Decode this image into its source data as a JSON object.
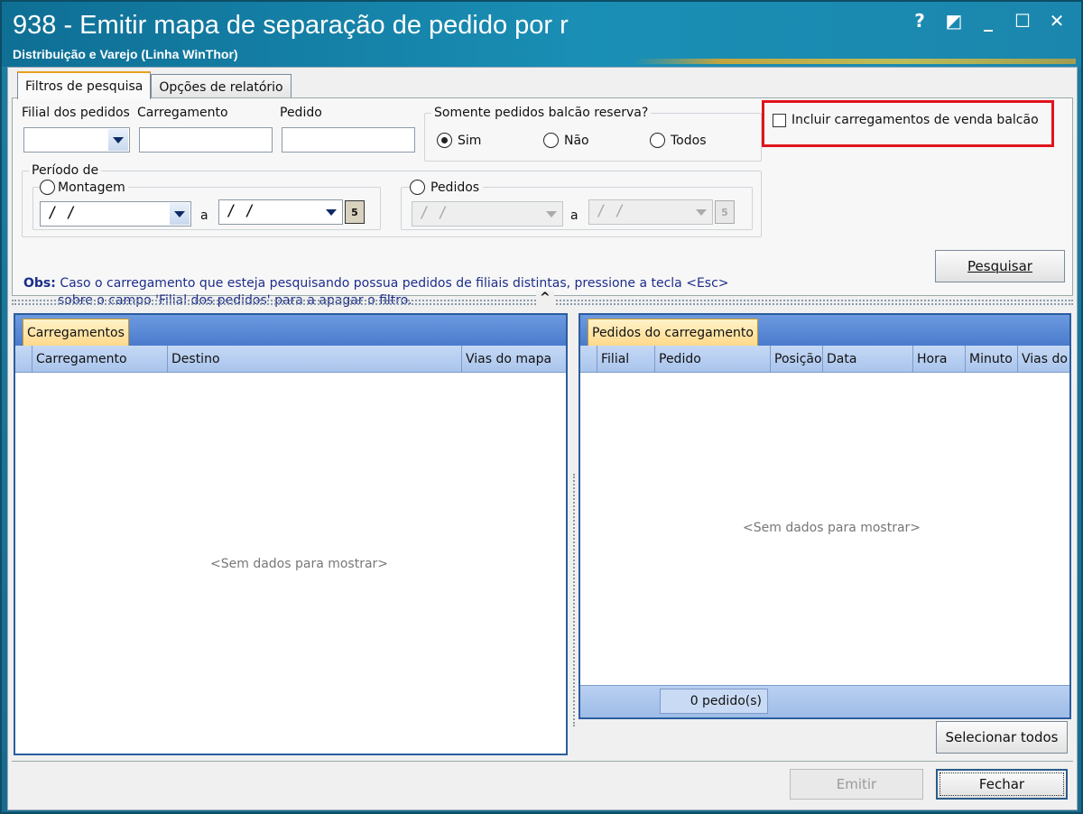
{
  "window": {
    "title": "938 - Emitir mapa de separação de pedido por r",
    "subtitle": "Distribuição e Varejo (Linha WinThor)",
    "controls": [
      "?",
      "◩",
      "_",
      "☐",
      "✕"
    ]
  },
  "tabs": [
    {
      "label": "Filtros de pesquisa",
      "active": true
    },
    {
      "label": "Opções de relatório",
      "active": false
    }
  ],
  "filters": {
    "filial_label": "Filial dos pedidos",
    "filial_value": "",
    "carregamento_label": "Carregamento",
    "carregamento_value": "",
    "pedido_label": "Pedido",
    "pedido_value": "",
    "balcao_group_label": "Somente pedidos balcão reserva?",
    "balcao_options": [
      {
        "label": "Sim",
        "selected": true
      },
      {
        "label": "Não",
        "selected": false
      },
      {
        "label": "Todos",
        "selected": false
      }
    ],
    "incluir_label": "Incluir carregamentos de venda balcão",
    "incluir_checked": false,
    "periodo_label": "Período de",
    "montagem_label": "Montagem",
    "montagem_from": "/ /",
    "montagem_to": "/ /",
    "sep_a": "a",
    "pedidos_label": "Pedidos",
    "pedidos_from": "/ /",
    "pedidos_to": "/ /",
    "cal_glyph": "5"
  },
  "obs": {
    "prefix": "Obs:",
    "line1": "Caso o carregamento que esteja pesquisando possua pedidos de filiais distintas, pressione a tecla <Esc>",
    "line2": "sobre o campo 'Filial dos pedidos' para a apagar o filtro."
  },
  "buttons": {
    "pesquisar": "Pesquisar",
    "selecionar_todos": "Selecionar todos",
    "emitir": "Emitir",
    "fechar": "Fechar"
  },
  "carregamentos_grid": {
    "tab_label": "Carregamentos",
    "columns": [
      "Carregamento",
      "Destino",
      "Vias do mapa"
    ],
    "empty_text": "<Sem dados para mostrar>"
  },
  "pedidos_grid": {
    "tab_label": "Pedidos do carregamento",
    "columns": [
      "Filial",
      "Pedido",
      "Posição",
      "Data",
      "Hora",
      "Minuto",
      "Vias do"
    ],
    "empty_text": "<Sem dados para mostrar>",
    "footer_count": "0 pedido(s)"
  },
  "colors": {
    "title_bg": "#1a8fb5",
    "grid_border": "#2b5d9e",
    "highlight": "#e0141c",
    "obs_text": "#1d2d8a"
  }
}
